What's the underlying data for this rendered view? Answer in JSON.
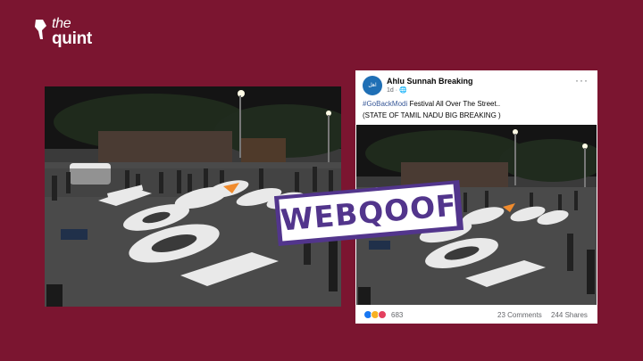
{
  "brand": {
    "line1": "the",
    "line2": "quint"
  },
  "post": {
    "page_name": "Ahlu Sunnah Breaking",
    "avatar_text": "اهل السنة",
    "time": "1d · ",
    "more_label": "···",
    "hashtag": "#GoBackModi",
    "line1_rest": " Festival All Over The Street..",
    "line2": "(STATE OF TAMIL NADU BIG BREAKING )",
    "reaction_count": "683",
    "comments": "23 Comments",
    "shares": "244 Shares"
  },
  "badge": {
    "text": "WEBQOOF"
  },
  "colors": {
    "background": "#7b1530",
    "badge_purple": "#52358c",
    "hashtag_blue": "#385898"
  }
}
